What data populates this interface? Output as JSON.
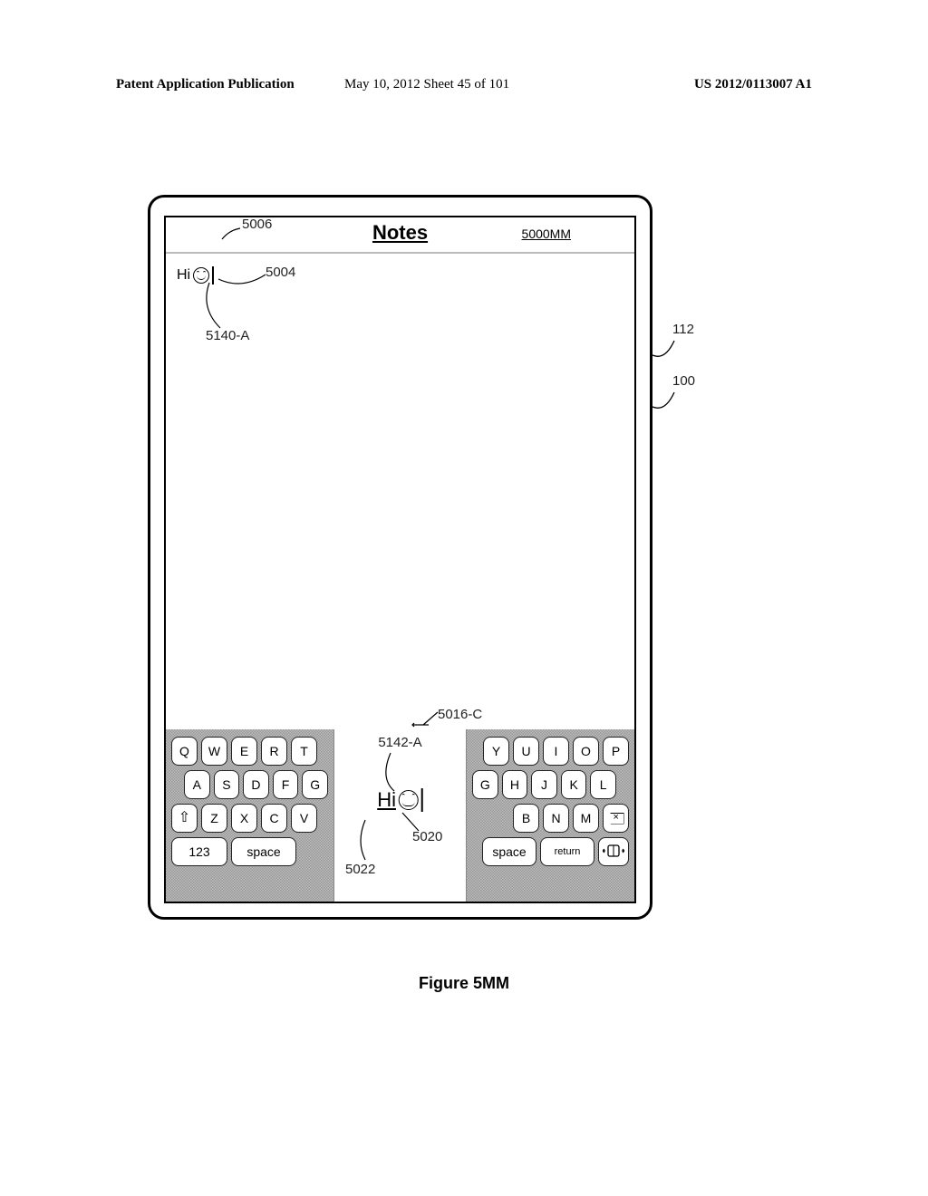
{
  "header": {
    "left": "Patent Application Publication",
    "center": "May 10, 2012  Sheet 45 of 101",
    "right": "US 2012/0113007 A1"
  },
  "title": "Notes",
  "figure_id": "5000MM",
  "typed": {
    "text": "Hi"
  },
  "center_preview": {
    "text": "Hi"
  },
  "keyboard": {
    "left": {
      "row1": [
        "Q",
        "W",
        "E",
        "R",
        "T"
      ],
      "row2": [
        "A",
        "S",
        "D",
        "F",
        "G"
      ],
      "row3": [
        "⇧",
        "Z",
        "X",
        "C",
        "V"
      ],
      "row4": {
        "mode": "123",
        "space": "space"
      }
    },
    "right": {
      "row1": [
        "Y",
        "U",
        "I",
        "O",
        "P"
      ],
      "row2": [
        "G",
        "H",
        "J",
        "K",
        "L"
      ],
      "row3": [
        "B",
        "N",
        "M",
        "del"
      ],
      "row4": {
        "space": "space",
        "return": "return"
      }
    }
  },
  "refs": {
    "r5006": "5006",
    "r5004": "5004",
    "r5140A": "5140-A",
    "r112": "112",
    "r100": "100",
    "r5016C": "5016-C",
    "r5142A": "5142-A",
    "r5020": "5020",
    "r5022": "5022"
  },
  "figure_caption": "Figure 5MM"
}
